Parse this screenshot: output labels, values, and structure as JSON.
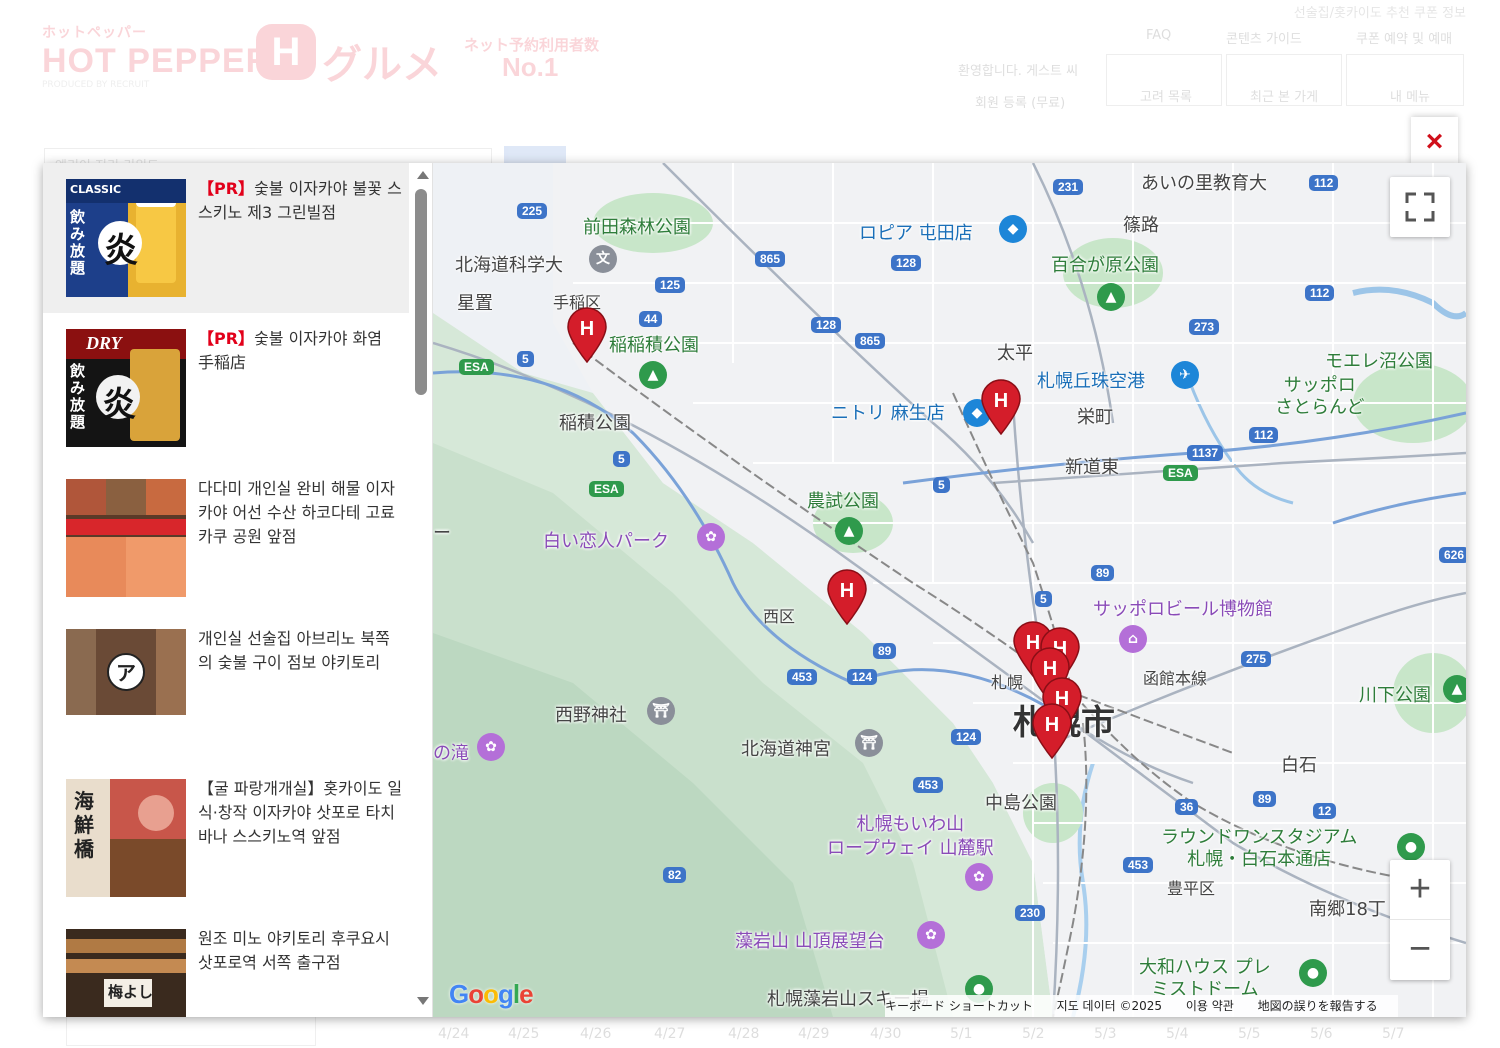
{
  "background": {
    "top_line": "선술집/홋카이도 추천 쿠폰 정보",
    "logo_kana": "ホットペッパー",
    "logo_main": "HOT PEPPER",
    "logo_sub": "PRODUCED BY RECRUIT",
    "logo_h": "H",
    "logo_gourmet": "グルメ",
    "badge_text": "ネット予約利用者数",
    "badge_no1": "No.1",
    "links": [
      "FAQ",
      "콘텐츠 가이드",
      "쿠폰 예약 및 예매"
    ],
    "welcome": "환영합니다. 게스트 씨",
    "register": "회원 등록 (무료)",
    "menu_labels": [
      "고려 목록",
      "최근 본 가게",
      "내 메뉴"
    ],
    "search_placeholder": "엔리이 지리 키워드",
    "dates": [
      "4/24",
      "4/25",
      "4/26",
      "4/27",
      "4/28",
      "4/29",
      "4/30",
      "5/1",
      "5/2",
      "5/3",
      "5/4",
      "5/5",
      "5/6",
      "5/7"
    ]
  },
  "modal": {
    "close_label": "×",
    "shops": [
      {
        "pr": "【PR】",
        "name": "숯불 이자카야 불꽃 스스키노 제3 그린빌점"
      },
      {
        "pr": "【PR】",
        "name": "숯불 이자카야 화염 手稲店"
      },
      {
        "pr": "",
        "name": "다다미 개인실 완비 해물 이자카야 어선 수산 하코다테 고료카쿠 공원 앞점"
      },
      {
        "pr": "",
        "name": "개인실 선술집 아브리노 북쪽의 숯불 구이 점보 야키토리"
      },
      {
        "pr": "",
        "name": "【굴 파랑개개실】홋카이도 일식·창작 이자카야 삿포로 타치바나 스스키노역 앞점"
      },
      {
        "pr": "",
        "name": "원조 미노 야키토리 후쿠요시 삿포로역 서쪽 출구점"
      }
    ],
    "thumb_texts": [
      "CLASSIC",
      "飲み放題",
      "炎",
      "DRY",
      "飲み放題",
      "炎",
      "ア",
      "海鮮橋",
      "梅よし"
    ]
  },
  "map": {
    "labels": {
      "aino_sato": "あいの里教育大",
      "maeda_park": "前田森林公園",
      "science_univ": "北海道科学大",
      "teine_ku": "手稲区",
      "hoshioki": "星置",
      "inazumi_park": "稲積公園",
      "inazumi_park2": "稲稲積公園",
      "ropia": "ロピア 屯田店",
      "shinoro": "篠路",
      "yurigahara": "百合が原公園",
      "taihei": "太平",
      "okadama": "札幌丘珠空港",
      "moerenuma": "モエレ沼公園",
      "sapporo_satoland": "サッポロ\nさとらんど",
      "nitori": "ニトリ 麻生店",
      "sakaemachi": "栄町",
      "shindo_higashi": "新道東",
      "noushi_park": "農試公園",
      "shiroi_koibito": "白い恋人パーク",
      "nishi_ku": "西区",
      "sapporo_beer": "サッポロビール博物館",
      "hakodate_line": "函館本線",
      "kawashimo_park": "川下公園",
      "nishino_shrine": "西野神社",
      "hokkaido_jingu": "北海道神宮",
      "sapporo_city": "札幌市",
      "sapporo_st": "札幌",
      "falls": "の滝",
      "nakajima_park": "中島公園",
      "moiwa_ropeway": "札幌もいわ山\nロープウェイ 山麓駅",
      "shiroishi": "白石",
      "round1": "ラウンドワンスタジアム\n札幌・白石本通店",
      "toyohira_ku": "豊平区",
      "nango": "南郷18丁",
      "moiwa_top": "藻岩山 山頂展望台",
      "daiwa": "大和ハウス プレ\nミストドーム",
      "ski": "札幌藻岩山スキー場",
      "dash": "ー"
    },
    "route_numbers": [
      "231",
      "112",
      "225",
      "865",
      "128",
      "125",
      "44",
      "128",
      "865",
      "273",
      "112",
      "5",
      "ESA",
      "5",
      "ESA",
      "1137",
      "112",
      "ESA",
      "5",
      "626",
      "89",
      "5",
      "275",
      "89",
      "453",
      "124",
      "124",
      "453",
      "36",
      "89",
      "12",
      "453",
      "82",
      "230",
      "5"
    ],
    "controls": {
      "zoom_in": "+",
      "zoom_out": "−"
    },
    "google_logo": "Google",
    "attribution": {
      "shortcuts": "キーボード ショートカット",
      "data": "지도 데이터 ©2025",
      "terms": "이용 약관",
      "report": "地図の誤りを報告する"
    },
    "pin_letter": "H"
  }
}
